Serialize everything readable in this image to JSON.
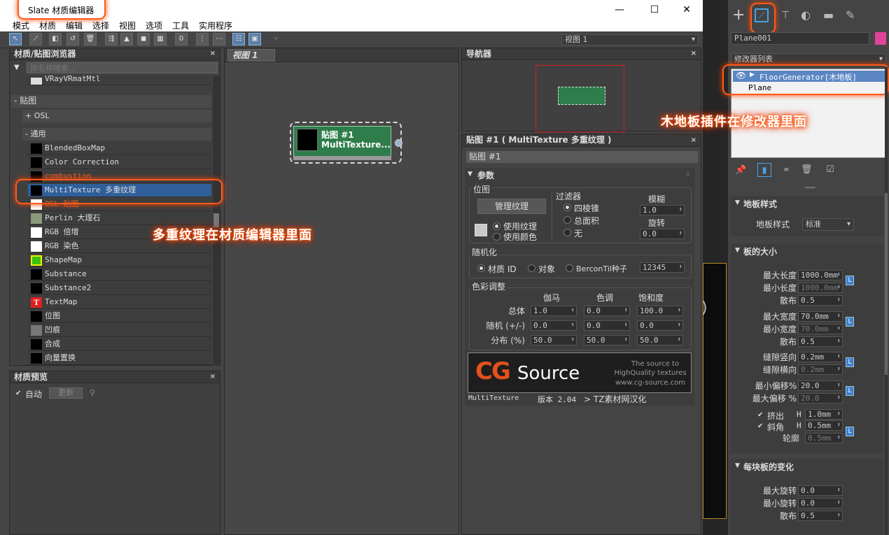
{
  "window": {
    "title": "Slate 材质编辑器",
    "min": "—",
    "max": "☐",
    "close": "✕"
  },
  "menu": [
    "模式",
    "材质",
    "编辑",
    "选择",
    "视图",
    "选项",
    "工具",
    "实用程序"
  ],
  "toolbar": {
    "view_dropdown": "视图 1"
  },
  "browser": {
    "title": "材质/贴图浏览器",
    "search_placeholder": "按名称搜索...",
    "top_item": "VRayVRmatMtl",
    "maps_group": "贴图",
    "osl_group": "+ OSL",
    "general_group": "- 通用",
    "items": [
      {
        "label": "BlendedBoxMap",
        "color": "#000000"
      },
      {
        "label": "Color Correction",
        "color": "#000000"
      },
      {
        "label": "combustion",
        "color": "#000000"
      },
      {
        "label": "MultiTexture 多重纹理",
        "color": "#000000"
      },
      {
        "label": "OSL 贴图",
        "color": "#ffffff"
      },
      {
        "label": "Perlin 大理石",
        "color": "#8a9a7a"
      },
      {
        "label": "RGB 倍增",
        "color": "#ffffff"
      },
      {
        "label": "RGB 染色",
        "color": "#ffffff"
      },
      {
        "label": "ShapeMap",
        "color": "#39c20f"
      },
      {
        "label": "Substance",
        "color": "#000000"
      },
      {
        "label": "Substance2",
        "color": "#000000"
      },
      {
        "label": "TextMap",
        "color": "#e02020"
      },
      {
        "label": "位图",
        "color": "#000000"
      },
      {
        "label": "凹痕",
        "color": "#777777"
      },
      {
        "label": "合成",
        "color": "#000000"
      },
      {
        "label": "向量置换",
        "color": "#000000"
      }
    ],
    "textmap_glyph": "T"
  },
  "preview": {
    "title": "材质预览",
    "auto": "自动",
    "update": "更新"
  },
  "view": {
    "tab": "视图 1",
    "node_title": "贴图 #1",
    "node_subtitle": "MultiTexture..."
  },
  "navigator": {
    "title": "导航器"
  },
  "params": {
    "title": "贴图 #1 ( MultiTexture 多重纹理 )",
    "name": "贴图 #1",
    "rollout": "参数",
    "bitmap": {
      "label": "位图",
      "manage": "管理纹理",
      "use_texture": "使用纹理",
      "use_color": "使用颜色"
    },
    "filter": {
      "label": "过滤器",
      "options": [
        "四棱锥",
        "总面积",
        "无"
      ]
    },
    "blur": {
      "label": "模糊",
      "value": "1.0"
    },
    "rotate": {
      "label": "旋转",
      "value": "0.0"
    },
    "random": {
      "label": "随机化",
      "options": [
        "材质 ID",
        "对象",
        "BerconTil种子"
      ],
      "seed": "12345"
    },
    "color": {
      "label": "色彩调整",
      "cols": [
        "伽马",
        "色调",
        "饱和度"
      ],
      "rows": [
        {
          "label": "总体",
          "values": [
            "1.0",
            "0.0",
            "100.0"
          ]
        },
        {
          "label": "随机 (+/-)",
          "values": [
            "0.0",
            "0.0",
            "0.0"
          ]
        },
        {
          "label": "分布 (%)",
          "values": [
            "50.0",
            "50.0",
            "50.0"
          ]
        }
      ]
    },
    "banner": {
      "logo_cg": "CG",
      "logo_source": "Source",
      "tag1": "The source to",
      "tag2": "HighQuality textures",
      "tag3": "www.cg-source.com"
    },
    "footer": {
      "name": "MultiTexture",
      "version": "版本 2.04",
      "credit": "> TZ素材网汉化"
    }
  },
  "cmd": {
    "object_name": "Plane001",
    "object_color": "#e0449a",
    "modifier_list": "修改器列表",
    "stack": [
      "FloorGenerator[木地板]",
      "Plane"
    ],
    "floor_style": {
      "header": "地板样式",
      "label": "地板样式",
      "value": "标准"
    },
    "board_size": {
      "header": "板的大小",
      "rows": [
        {
          "label": "最大长度",
          "value": "1000.0mm",
          "dis": false
        },
        {
          "label": "最小长度",
          "value": "1000.0mm",
          "dis": true
        },
        {
          "label": "散布",
          "value": "0.5",
          "dis": false
        },
        {
          "label": "最大宽度",
          "value": "70.0mm",
          "dis": false
        },
        {
          "label": "最小宽度",
          "value": "70.0mm",
          "dis": true
        },
        {
          "label": "散布",
          "value": "0.5",
          "dis": false
        },
        {
          "label": "缝隙竖向",
          "value": "0.2mm",
          "dis": false
        },
        {
          "label": "缝隙横向",
          "value": "0.2mm",
          "dis": true
        },
        {
          "label": "最小偏移%",
          "value": "20.0",
          "dis": false
        },
        {
          "label": "最大偏移 %",
          "value": "20.0",
          "dis": true
        }
      ],
      "extrude": "挤出",
      "extrude_h": "H",
      "extrude_v": "1.0mm",
      "bevel": "斜角",
      "bevel_h": "H",
      "bevel_v": "0.5mm",
      "outline": "轮廓",
      "outline_v": "0.5mm"
    },
    "variation": {
      "header": "每块板的变化",
      "rows": [
        {
          "label": "最大旋转",
          "value": "0.0"
        },
        {
          "label": "最小旋转",
          "value": "0.0"
        },
        {
          "label": "散布",
          "value": "0.5"
        }
      ]
    },
    "lock": "L"
  },
  "callouts": {
    "material": "多重纹理在材质编辑器里面",
    "modifier": "木地板插件在修改器里面"
  }
}
